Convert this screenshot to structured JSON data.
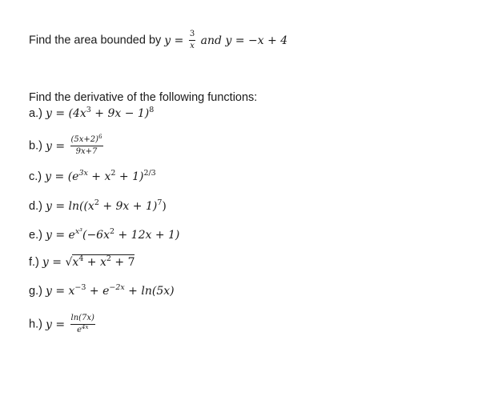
{
  "problem1": {
    "label": "Find the area bounded by",
    "eq1_lhs": "y",
    "eq_sign": " = ",
    "eq1_num": "3",
    "eq1_den": "x",
    "conj": " and ",
    "eq2_lhs": "y",
    "eq2_rhs": "−x + 4"
  },
  "problem2": {
    "heading": "Find the derivative of the following functions:",
    "items": [
      {
        "label": "a.)",
        "lhs": "y",
        "eq": " = ",
        "base": "(4x",
        "exp1": "3",
        "rest": " + 9x − 1)",
        "exp2": "8"
      },
      {
        "label": "b.)",
        "lhs": "y",
        "eq": " = ",
        "num_base": "(5x+2)",
        "num_exp": "6",
        "den": "9x+7"
      },
      {
        "label": "c.)",
        "lhs": "y",
        "eq": " = ",
        "p1": "(e",
        "e1": "3x",
        "p2": " + x",
        "e2": "2",
        "p3": " + 1)",
        "e3": "2/3"
      },
      {
        "label": "d.)",
        "lhs": "y",
        "eq": " = ",
        "p1": "ln((x",
        "e1": "2",
        "p2": " + 9x + 1)",
        "e2": "7",
        "p3": ")"
      },
      {
        "label": "e.)",
        "lhs": "y",
        "eq": " = ",
        "p1": "e",
        "e1": "x³",
        "p2": "(−6x",
        "e2": "2",
        "p3": " + 12x + 1)"
      },
      {
        "label": "f.)",
        "lhs": "y",
        "eq": " = ",
        "root": "√",
        "p1": "x",
        "e1": "4",
        "p2": " + x",
        "e2": "2",
        "p3": " + 7"
      },
      {
        "label": "g.)",
        "lhs": "y",
        "eq": " = ",
        "p1": "x",
        "e1": "−3",
        "p2": " + e",
        "e2": "−2x",
        "p3": " + ln(5x)"
      },
      {
        "label": "h.)",
        "lhs": "y",
        "eq": " = ",
        "num": "ln(7x)",
        "den_base": "e",
        "den_exp": "4x"
      }
    ]
  }
}
